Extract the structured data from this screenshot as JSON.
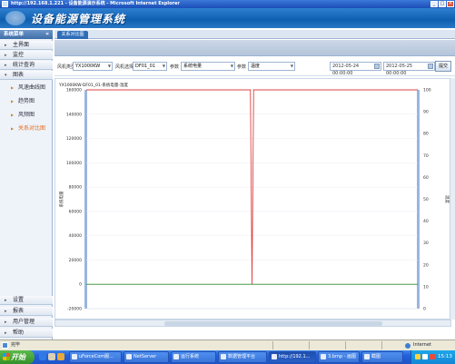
{
  "window": {
    "title": "http://192.168.1.221 - 设备能源演示系统 - Microsoft Internet Explorer"
  },
  "banner": {
    "title": "设备能源管理系统"
  },
  "sidebar": {
    "header": "系统菜单",
    "collapse_label": "«",
    "sections_top": [
      {
        "label": "主界面"
      },
      {
        "label": "监控"
      },
      {
        "label": "统计查询"
      },
      {
        "label": "图表"
      }
    ],
    "chart_items": [
      {
        "label": "风速曲线图"
      },
      {
        "label": "趋势图"
      },
      {
        "label": "风频图"
      },
      {
        "label": "关系对比图",
        "active": true
      }
    ],
    "sections_bottom": [
      {
        "label": "设置"
      },
      {
        "label": "报表"
      },
      {
        "label": "用户管理"
      },
      {
        "label": "帮助"
      }
    ]
  },
  "tabs": [
    {
      "label": "关系对比图"
    }
  ],
  "filter": {
    "label1": "风机类型",
    "select1": "YX1000KW",
    "label2": "风机选择",
    "select2": "DF01_01",
    "label3": "参数",
    "select3": "系统电量",
    "label4": "参数",
    "select4": "温度",
    "start_date": "2012-05-24 00:00:00",
    "end_date": "2012-05-25 00:00:00",
    "query_button": "提交"
  },
  "chart_data": {
    "type": "line",
    "title": "YX1000KW-DF01_01-系统电量-温度",
    "ylabel": "系统电量",
    "y2label": "温度",
    "ylim": [
      -20000,
      160000
    ],
    "y2lim": [
      0,
      100
    ],
    "yticks": [
      160000,
      140000,
      120000,
      100000,
      80000,
      60000,
      40000,
      20000,
      0,
      -20000
    ],
    "y2ticks": [
      100,
      90,
      80,
      70,
      60,
      50,
      40,
      30,
      20,
      10,
      0
    ],
    "series": [
      {
        "color": "#e04040",
        "axis": "left",
        "x": [
          0,
          0.495,
          0.5,
          0.505,
          1
        ],
        "values": [
          160000,
          160000,
          0,
          160000,
          160000
        ]
      },
      {
        "color": "#2e8b2e",
        "axis": "left",
        "x": [
          0,
          1
        ],
        "values": [
          0,
          0
        ]
      }
    ],
    "colors": {
      "left_axis": "#9ab6dc",
      "right_axis": "#9ab6dc",
      "grid": "#e8edf4"
    }
  },
  "statusbar": {
    "text": "完毕",
    "zone": "Internet"
  },
  "taskbar": {
    "start": "开始",
    "buttons": [
      {
        "label": "uForceCom服..."
      },
      {
        "label": "NetServer"
      },
      {
        "label": "运行系统"
      },
      {
        "label": "数据管理平台"
      },
      {
        "label": "http://192.1..."
      },
      {
        "label": "3.bmp - 画图"
      },
      {
        "label": "截图"
      }
    ],
    "clock": "15:13"
  }
}
